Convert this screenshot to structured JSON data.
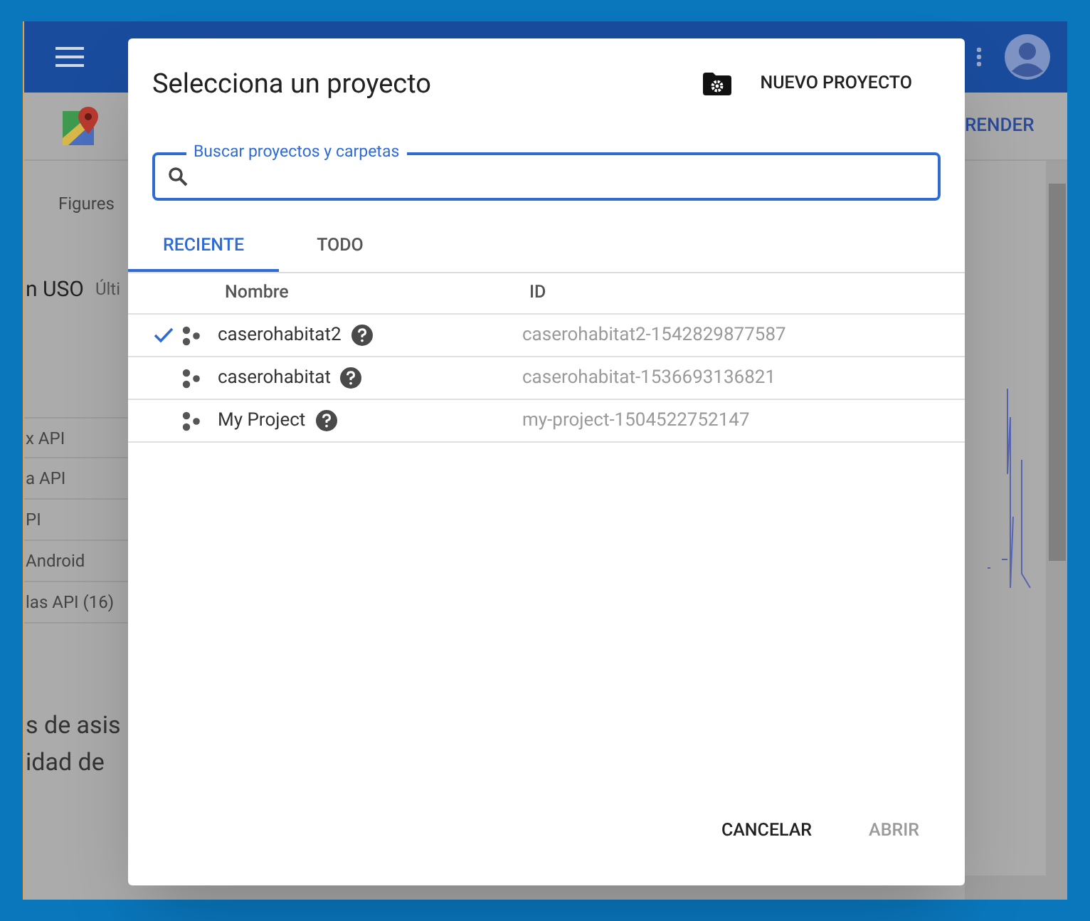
{
  "background_page": {
    "header_link": "RENDER",
    "left_texts": [
      {
        "text": "Figures",
        "kind": "small"
      },
      {
        "text": "n USO",
        "kind": "heading",
        "extra": "Últi"
      },
      {
        "text": "x API",
        "kind": "row"
      },
      {
        "text": "a API",
        "kind": "row"
      },
      {
        "text": "PI",
        "kind": "row"
      },
      {
        "text": "Android",
        "kind": "row"
      },
      {
        "text": "las API (16)",
        "kind": "row"
      },
      {
        "text": "s de asis",
        "kind": "big"
      },
      {
        "text": "idad de",
        "kind": "big"
      }
    ]
  },
  "dialog": {
    "title": "Selecciona un proyecto",
    "new_project": "NUEVO PROYECTO",
    "search": {
      "label": "Buscar proyectos y carpetas"
    },
    "tabs": [
      {
        "label": "RECIENTE",
        "selected": true
      },
      {
        "label": "TODO",
        "selected": false
      }
    ],
    "columns": [
      "Nombre",
      "ID"
    ],
    "rows": [
      {
        "name": "caserohabitat2",
        "id": "caserohabitat2-1542829877587",
        "selected": true
      },
      {
        "name": "caserohabitat",
        "id": "caserohabitat-1536693136821",
        "selected": false
      },
      {
        "name": "My Project",
        "id": "my-project-1504522752147",
        "selected": false
      }
    ],
    "buttons": [
      {
        "label": "CANCELAR",
        "disabled": false
      },
      {
        "label": "ABRIR",
        "disabled": true
      }
    ]
  }
}
